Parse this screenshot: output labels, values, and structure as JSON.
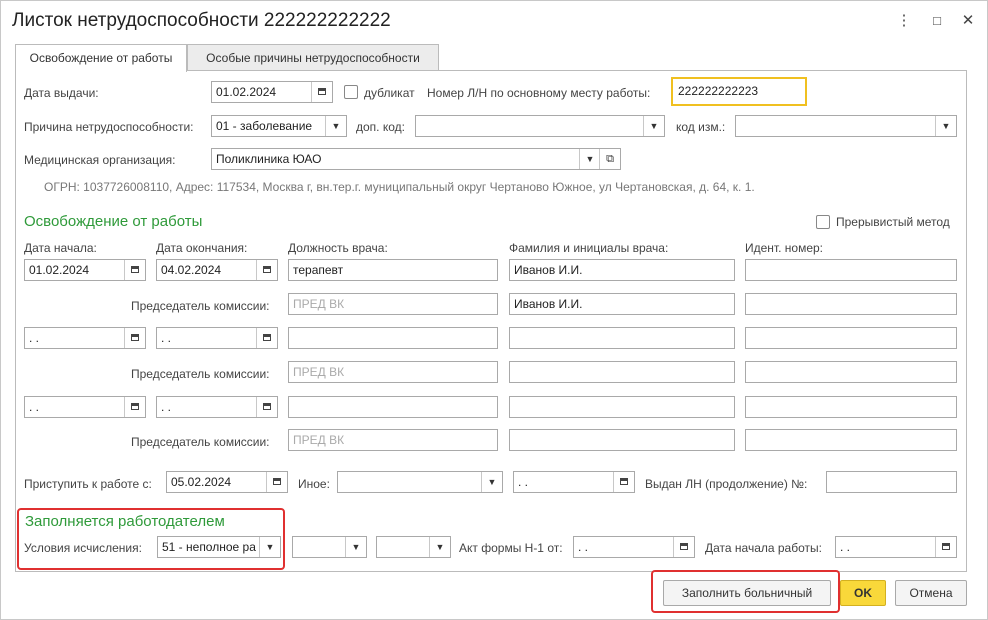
{
  "window": {
    "title": "Листок нетрудоспособности 222222222222",
    "menu_icon": "⋮",
    "maximize_icon": "□",
    "close_icon": "✕"
  },
  "tabs": [
    {
      "label": "Освобождение от работы",
      "active": true
    },
    {
      "label": "Особые причины нетрудоспособности",
      "active": false
    }
  ],
  "top": {
    "issue_date_label": "Дата выдачи:",
    "issue_date": "01.02.2024",
    "duplicate_label": "дубликат",
    "main_number_label": "Номер Л/Н по основному месту работы:",
    "main_number": "222222222223",
    "reason_label": "Причина нетрудоспособности:",
    "reason_value": "01 - заболевание",
    "extra_code_label": "доп. код:",
    "extra_code_value": "",
    "change_code_label": "код изм.:",
    "change_code_value": "",
    "med_org_label": "Медицинская организация:",
    "med_org_value": "Поликлиника ЮАО",
    "ogrn_text": "ОГРН: 1037726008110, Адрес: 117534, Москва г, вн.тер.г. муниципальный округ Чертаново Южное, ул Чертановская, д. 64, к. 1."
  },
  "release": {
    "section_title": "Освобождение от работы",
    "intermittent_label": "Прерывистый метод",
    "col_start": "Дата начала:",
    "col_end": "Дата окончания:",
    "col_position": "Должность врача:",
    "col_doctor": "Фамилия и инициалы врача:",
    "col_id": "Идент.  номер:",
    "chairman_label": "Председатель комиссии:",
    "chairman_placeholder": "ПРЕД ВК",
    "empty_date": " .  .",
    "rows": [
      {
        "start": "01.02.2024",
        "end": "04.02.2024",
        "position": "терапевт",
        "doctor": "Иванов И.И.",
        "chair_doctor": "Иванов И.И."
      },
      {
        "start": "",
        "end": "",
        "position": "",
        "doctor": "",
        "chair_doctor": ""
      },
      {
        "start": "",
        "end": "",
        "position": "",
        "doctor": "",
        "chair_doctor": ""
      }
    ]
  },
  "bottom": {
    "return_label": "Приступить к работе с:",
    "return_date": "05.02.2024",
    "other_label": "Иное:",
    "other_value": "",
    "other_date": " .  .",
    "continuation_label": "Выдан ЛН (продолжение) №:",
    "continuation_value": ""
  },
  "employer": {
    "section_title": "Заполняется работодателем",
    "calc_label": "Условия исчисления:",
    "calc_value": "51 - неполное ра",
    "act_label": "Акт формы Н-1 от:",
    "act_date": " .  .",
    "start_work_label": "Дата начала работы:",
    "start_work_date": " .  ."
  },
  "footer": {
    "fill_button": "Заполнить больничный",
    "ok_button": "OK",
    "cancel_button": "Отмена"
  },
  "colors": {
    "section_green": "#2f9a3a",
    "highlight_red": "#e03030",
    "focus_yellow": "#f0c020",
    "ok_yellow": "#f9d83a"
  }
}
